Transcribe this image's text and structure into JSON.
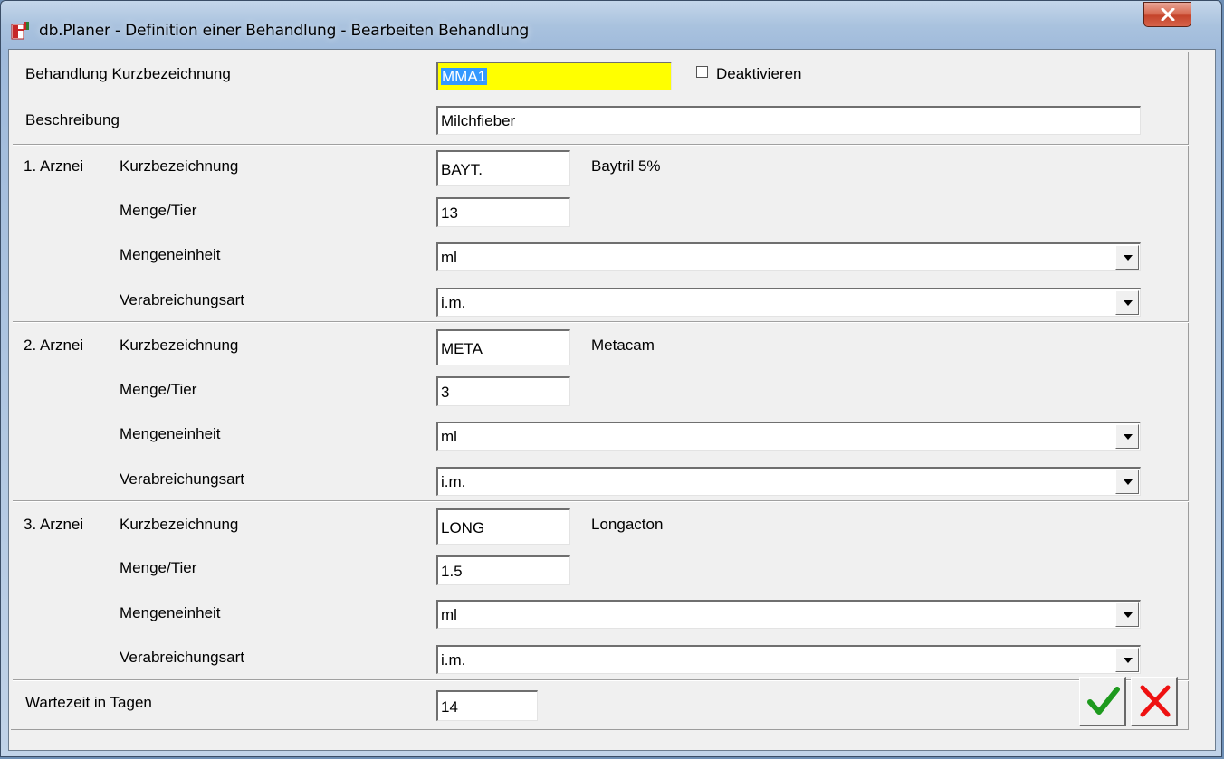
{
  "window": {
    "title": "db.Planer - Definition einer Behandlung - Bearbeiten Behandlung"
  },
  "colors": {
    "highlight": "#ffff00",
    "ok": "#1e9a1e",
    "cancel": "#ee1111"
  },
  "header": {
    "kurz_label": "Behandlung Kurzbezeichnung",
    "kurz_value": "MMA1",
    "deaktivieren_label": "Deaktivieren",
    "deaktivieren_checked": false,
    "beschreibung_label": "Beschreibung",
    "beschreibung_value": "Milchfieber"
  },
  "labels": {
    "kurz": "Kurzbezeichnung",
    "menge": "Menge/Tier",
    "einheit": "Mengeneinheit",
    "art": "Verabreichungsart"
  },
  "arznei": [
    {
      "title": "1. Arznei",
      "code": "BAYT.",
      "name": "Baytril 5%",
      "menge": "13",
      "einheit": "ml",
      "art": "i.m."
    },
    {
      "title": "2. Arznei",
      "code": "META",
      "name": "Metacam",
      "menge": "3",
      "einheit": "ml",
      "art": "i.m."
    },
    {
      "title": "3. Arznei",
      "code": "LONG",
      "name": "Longacton",
      "menge": "1.5",
      "einheit": "ml",
      "art": "i.m."
    }
  ],
  "wartezeit": {
    "label": "Wartezeit in Tagen",
    "value": "14"
  }
}
